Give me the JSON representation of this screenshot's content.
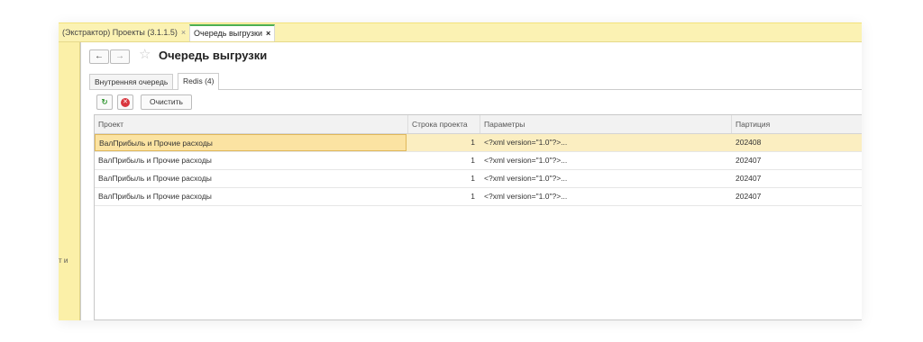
{
  "tabs": [
    {
      "label": "(Экстрактор) Проекты (3.1.1.5)",
      "close": "×"
    },
    {
      "label": "Очередь выгрузки",
      "close": "×"
    }
  ],
  "left_panel_text": "т и",
  "nav": {
    "back": "←",
    "forward": "→",
    "star": "☆"
  },
  "page_title": "Очередь выгрузки",
  "subtabs": [
    "Внутренняя очередь",
    "Redis (4)"
  ],
  "toolbar": {
    "refresh": "↻",
    "stop": "✕",
    "clear_label": "Очистить"
  },
  "colors": {
    "accent_green": "#4caf50",
    "selected_row": "#fbeec1",
    "tabbar": "#fbf2b3",
    "stop_red": "#d9363e"
  },
  "table": {
    "columns": [
      "Проект",
      "Строка проекта",
      "Параметры",
      "Партиция"
    ],
    "rows": [
      [
        "ВалПрибыль и Прочие расходы",
        "1",
        "<?xml version=\"1.0\"?>...",
        "202408"
      ],
      [
        "ВалПрибыль и Прочие расходы",
        "1",
        "<?xml version=\"1.0\"?>...",
        "202407"
      ],
      [
        "ВалПрибыль и Прочие расходы",
        "1",
        "<?xml version=\"1.0\"?>...",
        "202407"
      ],
      [
        "ВалПрибыль и Прочие расходы",
        "1",
        "<?xml version=\"1.0\"?>...",
        "202407"
      ]
    ]
  }
}
